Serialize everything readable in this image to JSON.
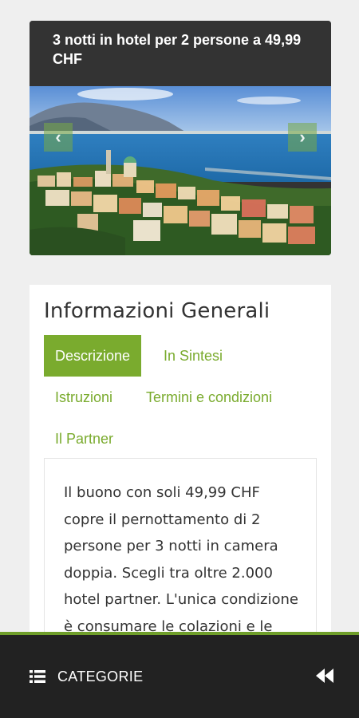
{
  "deal": {
    "title": "3 notti in hotel per 2 persone a 49,99 CHF",
    "prev_icon": "chevron-left-icon",
    "next_icon": "chevron-right-icon"
  },
  "info": {
    "heading": "Informazioni Generali",
    "tabs": [
      {
        "label": "Descrizione",
        "active": true
      },
      {
        "label": "In Sintesi",
        "active": false
      },
      {
        "label": "Istruzioni",
        "active": false
      },
      {
        "label": "Termini e condizioni",
        "active": false
      },
      {
        "label": "Il Partner",
        "active": false
      }
    ],
    "description": "Il buono con soli 49,99 CHF copre il pernottamento di 2 persone per 3 notti in camera doppia. Scegli tra oltre 2.000 hotel partner. L'unica condizione è consumare le colazioni e le"
  },
  "bottom_bar": {
    "menu_icon": "list-icon",
    "categories_label": "CATEGORIE",
    "collapse_icon": "rewind-icon"
  },
  "colors": {
    "accent": "#7aab2e",
    "dark": "#222222",
    "title_bg": "#333333"
  }
}
